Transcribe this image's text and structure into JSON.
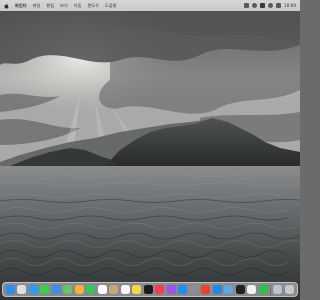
{
  "menubar": {
    "app_name": "파인더",
    "items": [
      "파일",
      "편집",
      "보기",
      "이동",
      "윈도우",
      "도움말"
    ],
    "clock": "10:09"
  },
  "status_icons": [
    "control-center-icon",
    "wifi-icon",
    "search-icon",
    "siri-icon",
    "battery-icon"
  ],
  "dock": {
    "items": [
      {
        "name": "finder-icon",
        "color": "#2f8cf0"
      },
      {
        "name": "launchpad-icon",
        "color": "#e0e0e0"
      },
      {
        "name": "safari-icon",
        "color": "#2e9cf5"
      },
      {
        "name": "messages-icon",
        "color": "#3bcf4e"
      },
      {
        "name": "mail-icon",
        "color": "#3d8fe8"
      },
      {
        "name": "maps-icon",
        "color": "#6cc16b"
      },
      {
        "name": "photos-icon",
        "color": "#f4b23a"
      },
      {
        "name": "facetime-icon",
        "color": "#34c759"
      },
      {
        "name": "calendar-icon",
        "color": "#ffffff"
      },
      {
        "name": "contacts-icon",
        "color": "#c9a47a"
      },
      {
        "name": "reminders-icon",
        "color": "#f5f5f5"
      },
      {
        "name": "notes-icon",
        "color": "#f7d64a"
      },
      {
        "name": "tv-icon",
        "color": "#1c1c1e"
      },
      {
        "name": "music-icon",
        "color": "#fa3c55"
      },
      {
        "name": "podcasts-icon",
        "color": "#9b55e6"
      },
      {
        "name": "app-store-icon",
        "color": "#1f8ef1"
      },
      {
        "name": "system-settings-icon",
        "color": "#8e8e93"
      },
      {
        "name": "chrome-icon",
        "color": "#ea4335"
      },
      {
        "name": "vscode-icon",
        "color": "#1e88e5"
      },
      {
        "name": "preview-icon",
        "color": "#5fa8e6"
      },
      {
        "name": "terminal-icon",
        "color": "#222222"
      },
      {
        "name": "textedit-icon",
        "color": "#f2f2f2"
      },
      {
        "name": "numbers-icon",
        "color": "#2fbf4b"
      }
    ],
    "trailing": [
      {
        "name": "downloads-icon",
        "color": "#b9c4d0"
      },
      {
        "name": "trash-icon",
        "color": "#c8c8cc"
      }
    ]
  }
}
